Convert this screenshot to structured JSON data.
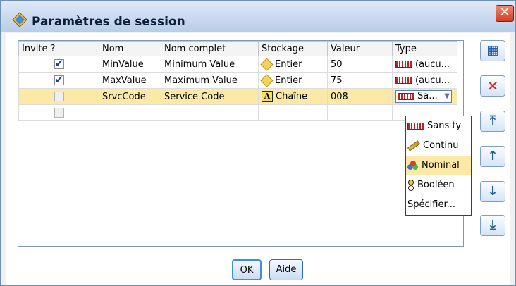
{
  "window": {
    "title": "Paramètres de session",
    "close_symbol": "✕"
  },
  "table": {
    "columns": [
      "Invite ?",
      "Nom",
      "Nom complet",
      "Stockage",
      "Valeur",
      "Type"
    ],
    "rows": [
      {
        "invite": true,
        "nom": "MinValue",
        "nom_complet": "Minimum Value",
        "stockage": "Entier",
        "stockage_icon": "diamond-icon",
        "valeur": "50",
        "type": "(aucu...",
        "type_icon": "ruler-icon"
      },
      {
        "invite": true,
        "nom": "MaxValue",
        "nom_complet": "Maximum Value",
        "stockage": "Entier",
        "stockage_icon": "diamond-icon",
        "valeur": "75",
        "type": "(aucu...",
        "type_icon": "ruler-icon"
      },
      {
        "invite": false,
        "nom": "SrvcCode",
        "nom_complet": "Service Code",
        "stockage": "Chaîne",
        "stockage_icon": "string-a-icon",
        "valeur": "008",
        "type": "Sa...",
        "type_icon": "ruler-icon",
        "selected": true
      },
      {
        "invite": false,
        "nom": "",
        "nom_complet": "",
        "stockage": "",
        "valeur": "",
        "type": ""
      }
    ]
  },
  "dropdown": {
    "items": [
      {
        "label": "Sans ty",
        "icon": "ruler-icon"
      },
      {
        "label": "Continu",
        "icon": "pencil-icon"
      },
      {
        "label": "Nominal",
        "icon": "circles-icon",
        "highlighted": true
      },
      {
        "label": "Booléen",
        "icon": "boolean-icon"
      },
      {
        "label": "Spécifier...",
        "icon": ""
      }
    ]
  },
  "side_buttons": [
    "add-parameter",
    "delete",
    "move-top",
    "move-up",
    "move-down",
    "move-bottom"
  ],
  "buttons": {
    "ok": "OK",
    "aide": "Aide"
  },
  "colors": {
    "selected_row": "#fde9a6",
    "accent": "#2e6cc0"
  }
}
